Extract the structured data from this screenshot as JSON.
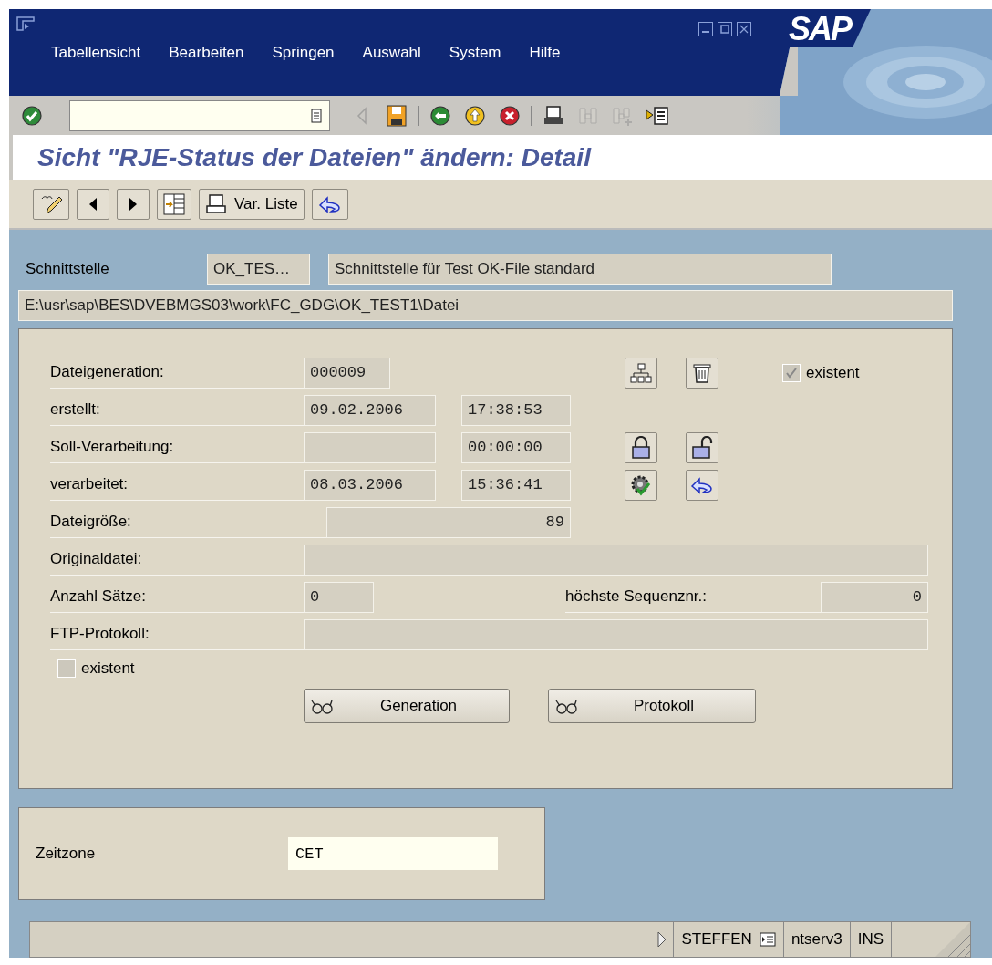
{
  "menu": [
    {
      "label": "Tabellensicht"
    },
    {
      "label": "Bearbeiten"
    },
    {
      "label": "Springen"
    },
    {
      "label": "Auswahl"
    },
    {
      "label": "System"
    },
    {
      "label": "Hilfe"
    }
  ],
  "logo": "SAP",
  "toolbar": {
    "buttons": [
      {
        "disabled": false
      },
      {
        "disabled": true
      },
      {
        "disabled": false
      },
      {
        "disabled": false
      },
      {
        "disabled": false
      },
      {
        "disabled": false
      },
      {
        "disabled": false
      },
      {
        "disabled": true
      },
      {
        "disabled": true
      },
      {
        "disabled": false
      }
    ]
  },
  "title": "Sicht \"RJE-Status der Dateien\" ändern: Detail",
  "app_toolbar": {
    "var_list_button": "Var. Liste"
  },
  "interface": {
    "label": "Schnittstelle",
    "code": "OK_TES…",
    "description": "Schnittstelle für Test OK-File standard",
    "path": "E:\\usr\\sap\\BES\\DVEBMGS03\\work\\FC_GDG\\OK_TEST1\\Datei"
  },
  "details": {
    "generation": {
      "label": "Dateigeneration:",
      "value": "000009"
    },
    "existent_top": {
      "label": "existent",
      "checked": true,
      "disabled": true
    },
    "created": {
      "label": "erstellt:",
      "date": "09.02.2006",
      "time": "17:38:53"
    },
    "planned": {
      "label": "Soll-Verarbeitung:",
      "time": "00:00:00"
    },
    "processed": {
      "label": "verarbeitet:",
      "date": "08.03.2006",
      "time": "15:36:41"
    },
    "size": {
      "label": "Dateigröße:",
      "value": "89"
    },
    "original": {
      "label": "Originaldatei:"
    },
    "records": {
      "label": "Anzahl Sätze:",
      "value": "0"
    },
    "sequence": {
      "label": "höchste Sequenznr.:",
      "value": "0"
    },
    "ftp": {
      "label": "FTP-Protokoll:"
    },
    "existent_bottom": {
      "label": "existent",
      "checked": false,
      "disabled": true
    },
    "buttons": [
      "Generation",
      "Protokoll"
    ]
  },
  "timezone": {
    "label": "Zeitzone",
    "value": "CET"
  },
  "status_bar": {
    "user": "STEFFEN",
    "server": "ntserv3",
    "mode": "INS"
  }
}
